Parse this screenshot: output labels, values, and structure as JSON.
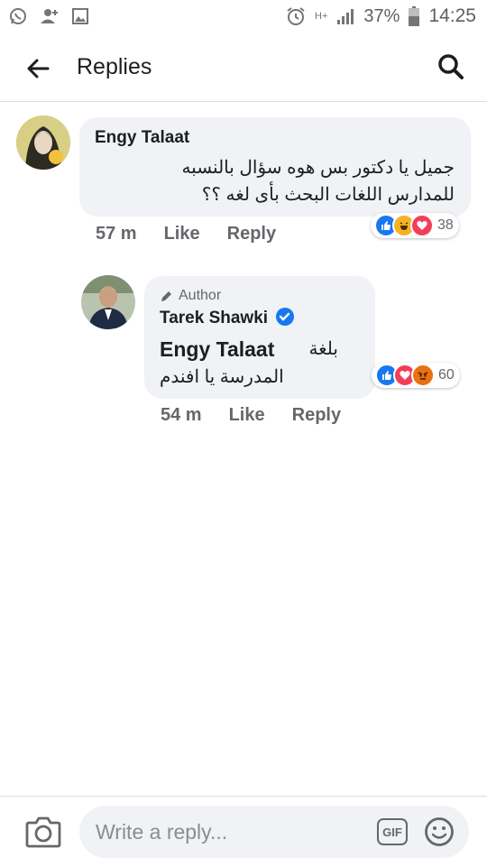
{
  "status_bar": {
    "battery": "37%",
    "time": "14:25",
    "network": "H+"
  },
  "header": {
    "title": "Replies"
  },
  "comments": [
    {
      "author": "Engy Talaat",
      "text_line1": "جميل يا دكتور بس هوه سؤال بالنسبه",
      "text_line2": "للمدارس اللغات البحث بأى لغه ؟؟",
      "reaction_count": "38",
      "time": "57 m",
      "like_label": "Like",
      "reply_label": "Reply"
    },
    {
      "badge": "Author",
      "author": "Tarek Shawki",
      "mention": "Engy Talaat",
      "text_line1": "بلغة",
      "text_line2": "المدرسة يا افندم",
      "reaction_count": "60",
      "time": "54 m",
      "like_label": "Like",
      "reply_label": "Reply"
    }
  ],
  "composer": {
    "placeholder": "Write a reply...",
    "gif_label": "GIF"
  },
  "colors": {
    "accent": "#1877f2",
    "bubble": "#f0f2f5",
    "secondary_text": "#65676b"
  }
}
